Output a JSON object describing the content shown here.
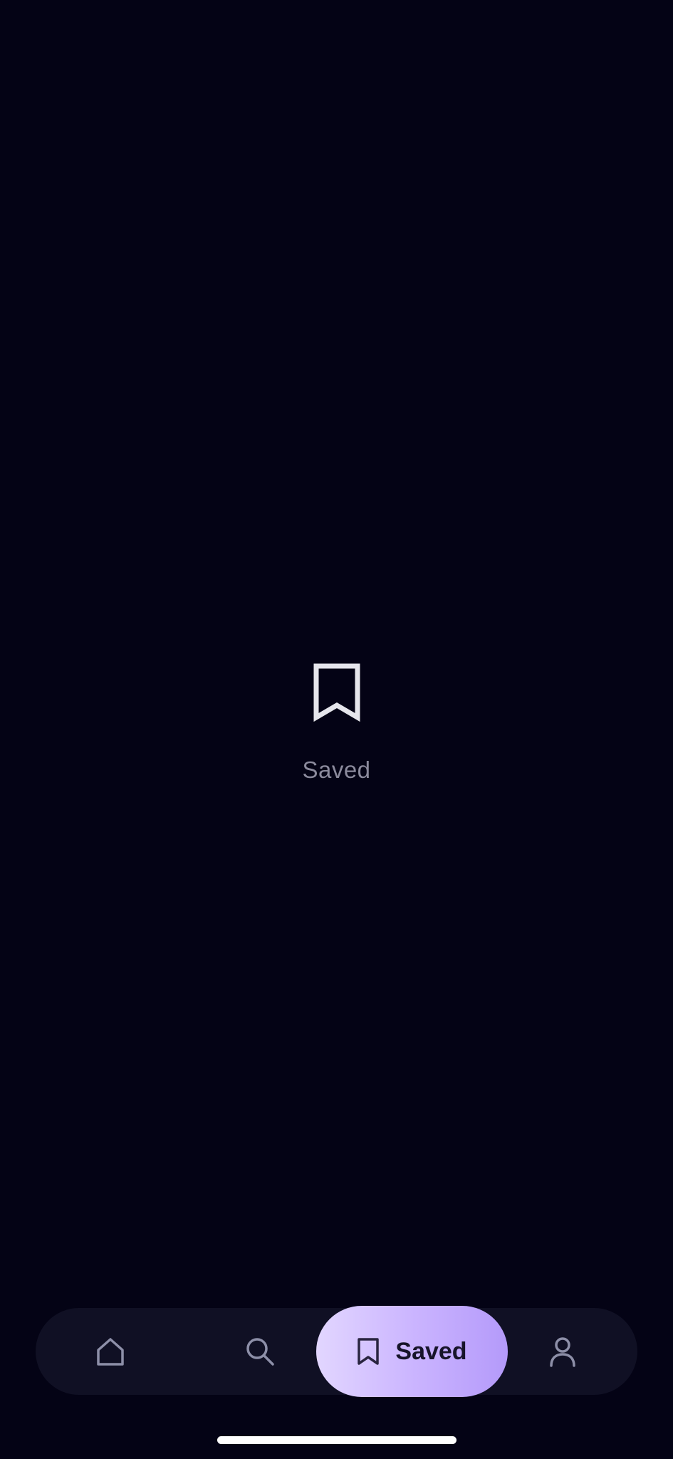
{
  "empty_state": {
    "icon": "bookmark-icon",
    "label": "Saved"
  },
  "tab_bar": {
    "tabs": [
      {
        "id": "home",
        "icon": "home-icon",
        "label": "",
        "active": false
      },
      {
        "id": "search",
        "icon": "search-icon",
        "label": "",
        "active": false
      },
      {
        "id": "saved",
        "icon": "bookmark-icon",
        "label": "Saved",
        "active": true
      },
      {
        "id": "profile",
        "icon": "user-icon",
        "label": "",
        "active": false
      }
    ]
  },
  "colors": {
    "background": "#040315",
    "tab_bar_background": "#101024",
    "active_pill_gradient": [
      "#e2d6ff",
      "#b49afa"
    ],
    "inactive_icon": "#8d8fa8",
    "muted_text": "#8b8a9c"
  }
}
